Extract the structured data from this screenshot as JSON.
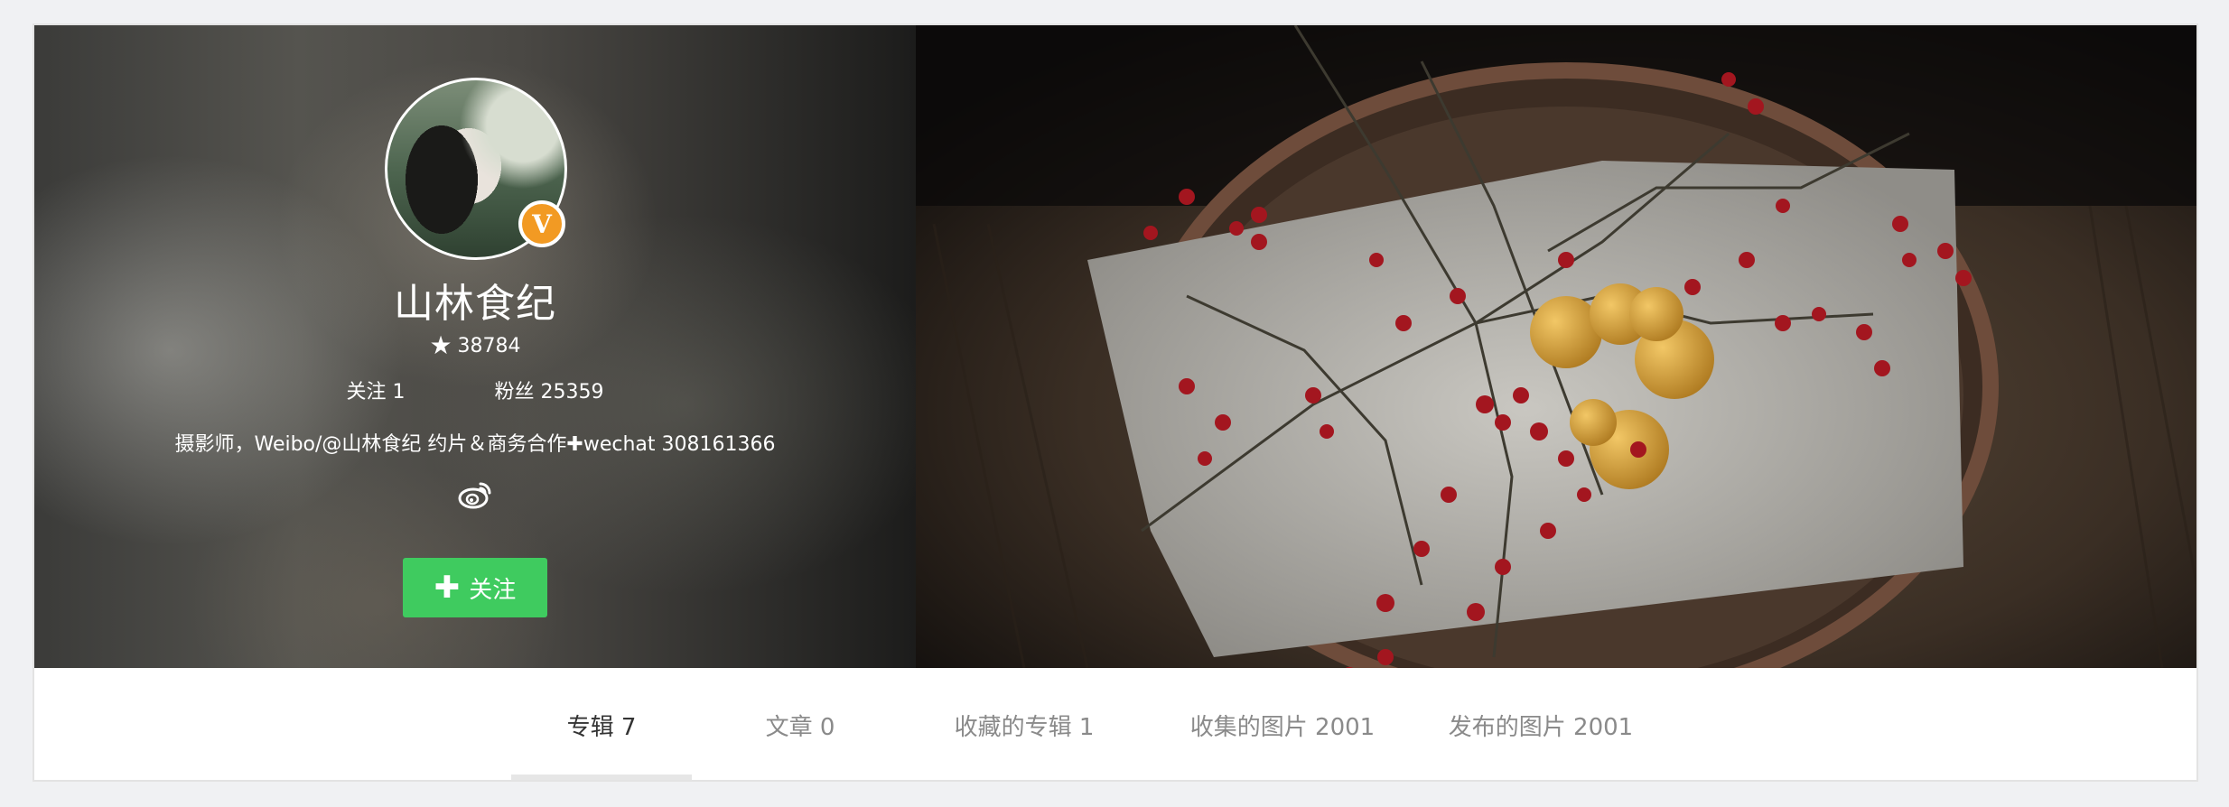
{
  "profile": {
    "username": "山林食纪",
    "verified_badge_label": "V",
    "likes": "38784",
    "following": "关注 1",
    "followers": "粉丝 25359",
    "bio": "摄影师，Weibo/@山林食纪 约片＆商务合作✚wechat 308161366",
    "follow_button_label": "关注"
  },
  "icons": {
    "likes_icon": "star-icon",
    "social_icon": "weibo-icon",
    "button_icon": "plus-icon",
    "badge_icon": "verified-icon"
  },
  "colors": {
    "follow_button": "#3fcb5f",
    "verified_badge": "#f29a23",
    "tab_active": "#333333",
    "tab_inactive": "#8a8a8a",
    "page_background": "#f0f1f3"
  },
  "tabs": [
    {
      "label": "专辑 7",
      "active": true
    },
    {
      "label": "文章 0",
      "active": false
    },
    {
      "label": "收藏的专辑 1",
      "active": false
    },
    {
      "label": "收集的图片 2001",
      "active": false
    },
    {
      "label": "发布的图片 2001",
      "active": false
    }
  ]
}
